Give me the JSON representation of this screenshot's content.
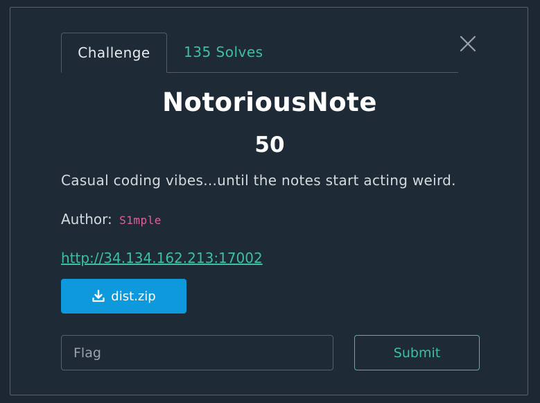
{
  "tabs": {
    "challenge": "Challenge",
    "solves": "135 Solves"
  },
  "challenge": {
    "name": "NotoriousNote",
    "points": "50",
    "description": "Casual coding vibes...until the notes start acting weird.",
    "author_label": "Author:",
    "author_name": "S1mple",
    "url": "http://34.134.162.213:17002"
  },
  "download": {
    "label": "dist.zip",
    "icon": "download-icon"
  },
  "flag_input": {
    "placeholder": "Flag",
    "value": ""
  },
  "submit": {
    "label": "Submit"
  },
  "colors": {
    "accent": "#3dbfa3",
    "download_button": "#0d99dc",
    "author": "#e0609a",
    "modal_bg": "#1e2a35"
  }
}
